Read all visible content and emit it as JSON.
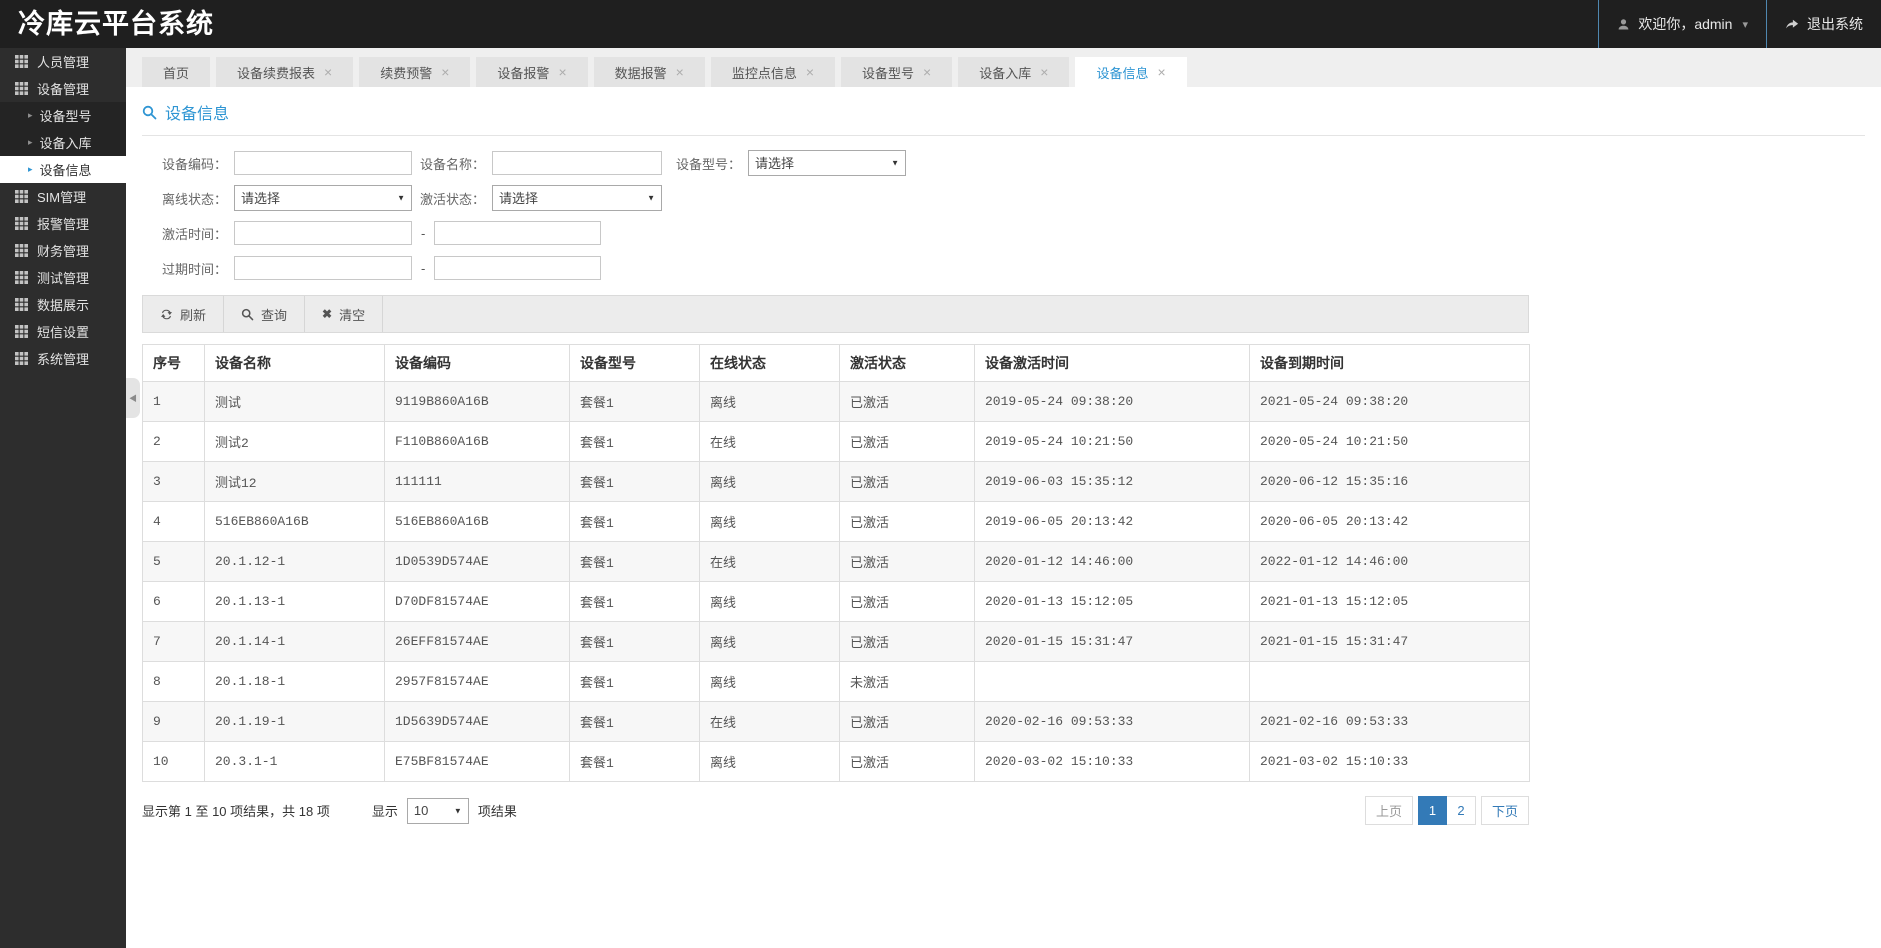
{
  "colors": {
    "accent": "#2e95d3",
    "pager_active": "#337ab7",
    "topbar_bg": "#1f1f1f",
    "sidebar_bg": "#2d2d2d",
    "topbar_separator": "#4f87b0"
  },
  "app": {
    "title": "冷库云平台系统"
  },
  "topbar": {
    "welcome": "欢迎你，admin",
    "logout": "退出系统"
  },
  "sidebar": {
    "items": [
      {
        "label": "人员管理"
      },
      {
        "label": "设备管理"
      },
      {
        "label": "设备型号"
      },
      {
        "label": "设备入库"
      },
      {
        "label": "设备信息"
      },
      {
        "label": "SIM管理"
      },
      {
        "label": "报警管理"
      },
      {
        "label": "财务管理"
      },
      {
        "label": "测试管理"
      },
      {
        "label": "数据展示"
      },
      {
        "label": "短信设置"
      },
      {
        "label": "系统管理"
      }
    ]
  },
  "tabs": [
    {
      "label": "首页"
    },
    {
      "label": "设备续费报表"
    },
    {
      "label": "续费预警"
    },
    {
      "label": "设备报警"
    },
    {
      "label": "数据报警"
    },
    {
      "label": "监控点信息"
    },
    {
      "label": "设备型号"
    },
    {
      "label": "设备入库"
    },
    {
      "label": "设备信息"
    }
  ],
  "search": {
    "title": "设备信息",
    "fields": {
      "device_code_label": "设备编码：",
      "device_name_label": "设备名称：",
      "device_model_label": "设备型号：",
      "offline_status_label": "离线状态：",
      "active_status_label": "激活状态：",
      "activate_time_label": "激活时间：",
      "expire_time_label": "过期时间：",
      "select_placeholder": "请选择",
      "range_separator": "-"
    }
  },
  "toolbar": {
    "refresh": "刷新",
    "query": "查询",
    "clear": "清空"
  },
  "table": {
    "headers": [
      "序号",
      "设备名称",
      "设备编码",
      "设备型号",
      "在线状态",
      "激活状态",
      "设备激活时间",
      "设备到期时间"
    ],
    "rows": [
      {
        "no": "1",
        "name": "测试",
        "code": "9119B860A16B",
        "model": "套餐1",
        "online": "离线",
        "activated": "已激活",
        "activate_time": "2019-05-24 09:38:20",
        "expire_time": "2021-05-24 09:38:20"
      },
      {
        "no": "2",
        "name": "测试2",
        "code": "F110B860A16B",
        "model": "套餐1",
        "online": "在线",
        "activated": "已激活",
        "activate_time": "2019-05-24 10:21:50",
        "expire_time": "2020-05-24 10:21:50"
      },
      {
        "no": "3",
        "name": "测试12",
        "code": "111111",
        "model": "套餐1",
        "online": "离线",
        "activated": "已激活",
        "activate_time": "2019-06-03 15:35:12",
        "expire_time": "2020-06-12 15:35:16"
      },
      {
        "no": "4",
        "name": "516EB860A16B",
        "code": "516EB860A16B",
        "model": "套餐1",
        "online": "离线",
        "activated": "已激活",
        "activate_time": "2019-06-05 20:13:42",
        "expire_time": "2020-06-05 20:13:42"
      },
      {
        "no": "5",
        "name": "20.1.12-1",
        "code": "1D0539D574AE",
        "model": "套餐1",
        "online": "在线",
        "activated": "已激活",
        "activate_time": "2020-01-12 14:46:00",
        "expire_time": "2022-01-12 14:46:00"
      },
      {
        "no": "6",
        "name": "20.1.13-1",
        "code": "D70DF81574AE",
        "model": "套餐1",
        "online": "离线",
        "activated": "已激活",
        "activate_time": "2020-01-13 15:12:05",
        "expire_time": "2021-01-13 15:12:05"
      },
      {
        "no": "7",
        "name": "20.1.14-1",
        "code": "26EFF81574AE",
        "model": "套餐1",
        "online": "离线",
        "activated": "已激活",
        "activate_time": "2020-01-15 15:31:47",
        "expire_time": "2021-01-15 15:31:47"
      },
      {
        "no": "8",
        "name": "20.1.18-1",
        "code": "2957F81574AE",
        "model": "套餐1",
        "online": "离线",
        "activated": "未激活",
        "activate_time": "",
        "expire_time": ""
      },
      {
        "no": "9",
        "name": "20.1.19-1",
        "code": "1D5639D574AE",
        "model": "套餐1",
        "online": "在线",
        "activated": "已激活",
        "activate_time": "2020-02-16 09:53:33",
        "expire_time": "2021-02-16 09:53:33"
      },
      {
        "no": "10",
        "name": "20.3.1-1",
        "code": "E75BF81574AE",
        "model": "套餐1",
        "online": "离线",
        "activated": "已激活",
        "activate_time": "2020-03-02 15:10:33",
        "expire_time": "2021-03-02 15:10:33"
      }
    ]
  },
  "footer": {
    "info": "显示第 1 至 10 项结果，共 18 项",
    "show_label": "显示",
    "page_size": "10",
    "suffix_label": "项结果"
  },
  "pagination": {
    "prev": "上页",
    "pages": [
      "1",
      "2"
    ],
    "current": "1",
    "next": "下页"
  }
}
